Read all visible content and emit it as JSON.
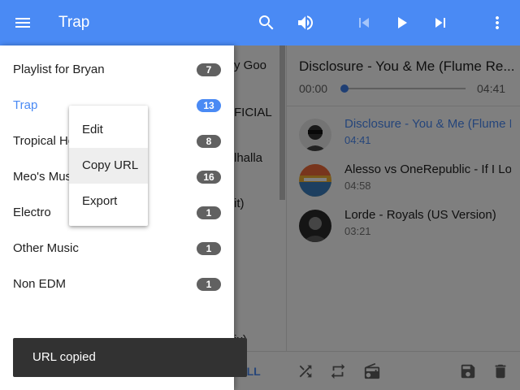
{
  "app_bar": {
    "title": "Trap",
    "icons": [
      "menu-icon",
      "search-icon",
      "volume-icon",
      "skip-previous-icon",
      "play-icon",
      "skip-next-icon",
      "more-vert-icon"
    ]
  },
  "background_list": {
    "fragments": [
      "y Goo",
      "FICIAL",
      "lhalla",
      "it)",
      "ix)"
    ]
  },
  "now_playing": {
    "title": "Disclosure - You & Me (Flume Re...",
    "current_time": "00:00",
    "total_time": "04:41",
    "progress": 0
  },
  "queue": [
    {
      "title": "Disclosure - You & Me (Flume Remix)",
      "time": "04:41",
      "active": true
    },
    {
      "title": "Alesso vs OneRepublic - If I Lose Myself",
      "time": "04:58",
      "active": false
    },
    {
      "title": "Lorde - Royals (US Version)",
      "time": "03:21",
      "active": false
    }
  ],
  "bottom_bar": {
    "add_all_label": "D ALL",
    "icons": [
      "shuffle-icon",
      "repeat-icon",
      "radio-icon",
      "save-icon",
      "delete-icon"
    ]
  },
  "playlists": [
    {
      "name": "Playlist for Bryan",
      "count": "7",
      "active": false
    },
    {
      "name": "Trap",
      "count": "13",
      "active": true
    },
    {
      "name": "Tropical House",
      "count": "8",
      "active": false
    },
    {
      "name": "Meo's Music",
      "count": "16",
      "active": false
    },
    {
      "name": "Electro",
      "count": "1",
      "active": false
    },
    {
      "name": "Other Music",
      "count": "1",
      "active": false
    },
    {
      "name": "Non EDM",
      "count": "1",
      "active": false
    }
  ],
  "context_menu": {
    "items": [
      "Edit",
      "Copy URL",
      "Export"
    ],
    "highlighted": "Copy URL"
  },
  "snackbar": {
    "message": "URL copied"
  },
  "colors": {
    "primary": "#4a8af4",
    "badge": "#616161",
    "snackbar": "#323232"
  }
}
